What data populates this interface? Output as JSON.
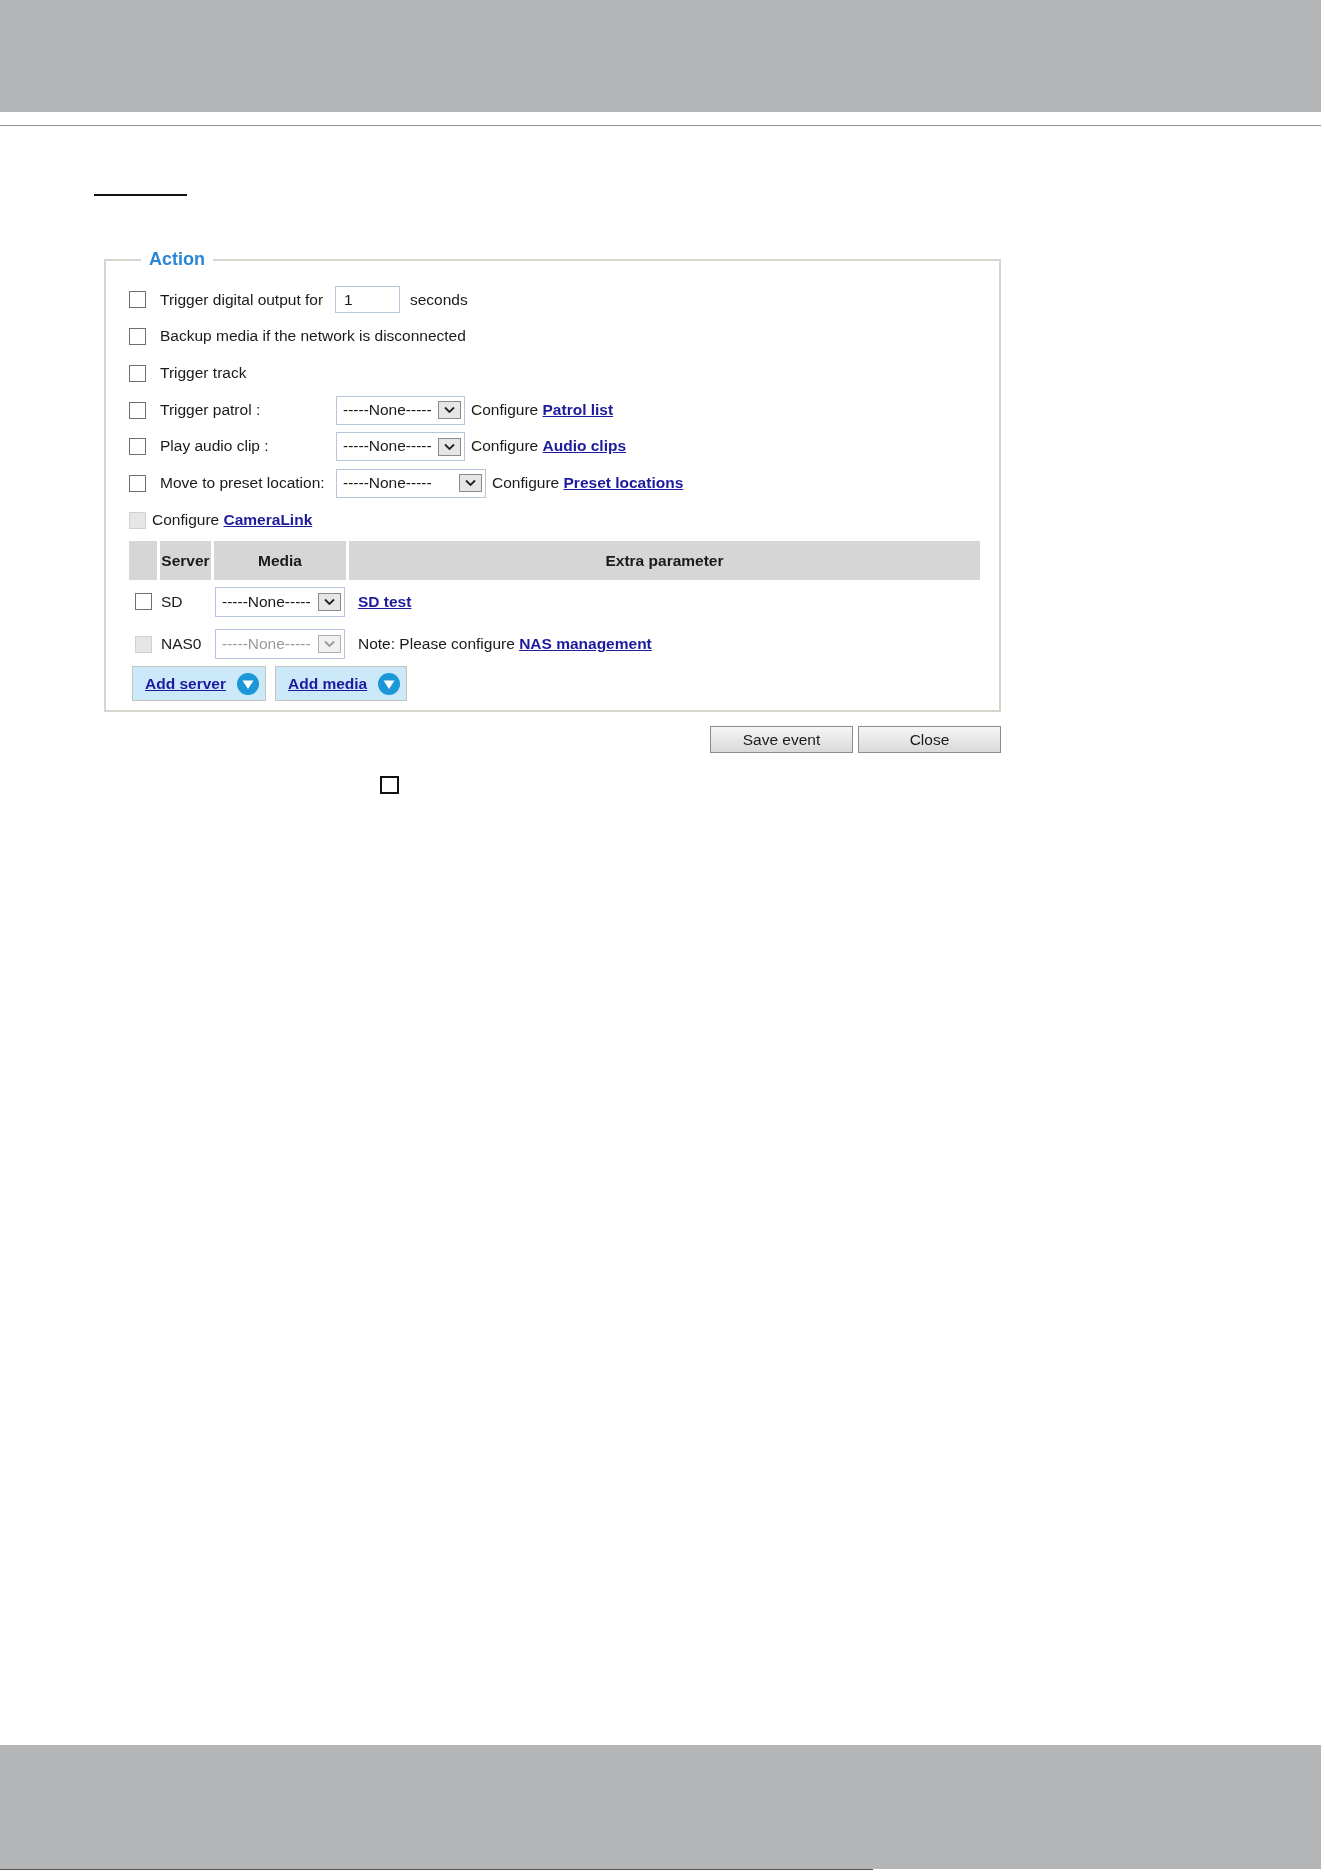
{
  "action": {
    "legend": "Action",
    "options": [
      {
        "kind": "input",
        "checked": false,
        "disabled": false,
        "label": "Trigger digital output for",
        "value": "1",
        "unit": "seconds"
      },
      {
        "kind": "plain",
        "checked": false,
        "disabled": false,
        "label": "Backup media if the network is disconnected"
      },
      {
        "kind": "plain",
        "checked": false,
        "disabled": false,
        "label": "Trigger track"
      },
      {
        "kind": "select",
        "checked": false,
        "disabled": false,
        "label": "Trigger patrol :",
        "select": "-----None-----",
        "note": "Configure",
        "link": "Patrol list"
      },
      {
        "kind": "select",
        "checked": false,
        "disabled": false,
        "label": "Play audio clip :",
        "select": "-----None-----",
        "note": "Configure",
        "link": "Audio clips"
      },
      {
        "kind": "select",
        "checked": false,
        "disabled": false,
        "label": "Move to preset location:",
        "select": "-----None-----",
        "note": "Configure",
        "link": "Preset locations"
      },
      {
        "kind": "link",
        "checked": false,
        "disabled": true,
        "note": "Configure",
        "link": "CameraLink"
      }
    ],
    "server_table": {
      "columns": [
        "Server",
        "Media",
        "Extra parameter"
      ],
      "rows": [
        {
          "checked": false,
          "disabled": false,
          "server": "SD",
          "media": "-----None-----",
          "extra": {
            "link": "SD test"
          }
        },
        {
          "checked": false,
          "disabled": true,
          "server": "NAS0",
          "media": "-----None-----",
          "extra": {
            "note": "Note: Please configure",
            "link": "NAS management"
          }
        }
      ]
    },
    "buttons": [
      "Add server",
      "Add media"
    ]
  },
  "dialog_buttons": [
    "Save event",
    "Close"
  ],
  "stray_checkbox": {
    "checked": false
  }
}
